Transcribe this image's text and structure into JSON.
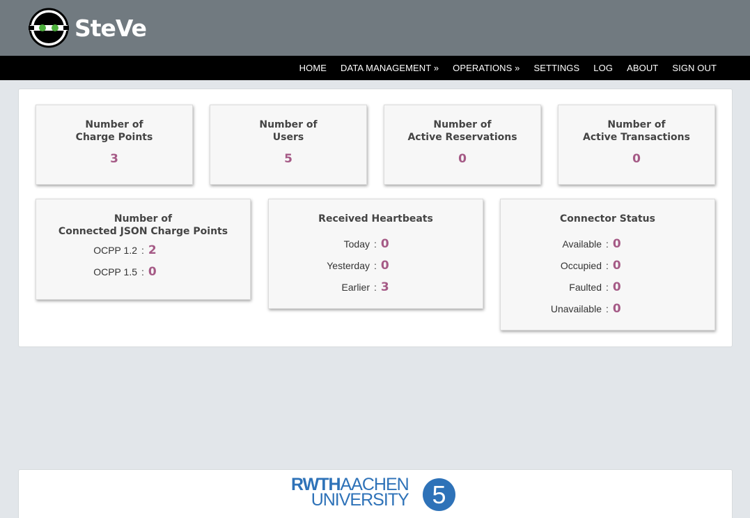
{
  "brand": {
    "name": "SteVe",
    "logo_icon": "robot-face-icon"
  },
  "nav": {
    "items": [
      {
        "label": "HOME"
      },
      {
        "label": "DATA MANAGEMENT »"
      },
      {
        "label": "OPERATIONS »"
      },
      {
        "label": "SETTINGS"
      },
      {
        "label": "LOG"
      },
      {
        "label": "ABOUT"
      },
      {
        "label": "SIGN OUT"
      }
    ]
  },
  "stats": {
    "charge_points": {
      "line1": "Number of",
      "line2": "Charge Points",
      "value": "3"
    },
    "users": {
      "line1": "Number of",
      "line2": "Users",
      "value": "5"
    },
    "reservations": {
      "line1": "Number of",
      "line2": "Active Reservations",
      "value": "0"
    },
    "transactions": {
      "line1": "Number of",
      "line2": "Active Transactions",
      "value": "0"
    }
  },
  "json_cp": {
    "line1": "Number of",
    "line2": "Connected JSON Charge Points",
    "rows": [
      {
        "label": "OCPP 1.2",
        "sep": ":",
        "value": "2"
      },
      {
        "label": "OCPP 1.5",
        "sep": ":",
        "value": "0"
      }
    ]
  },
  "heartbeats": {
    "title": "Received Heartbeats",
    "rows": [
      {
        "label": "Today",
        "sep": ":",
        "value": "0"
      },
      {
        "label": "Yesterday",
        "sep": ":",
        "value": "0"
      },
      {
        "label": "Earlier",
        "sep": ":",
        "value": "3"
      }
    ]
  },
  "connector": {
    "title": "Connector Status",
    "rows": [
      {
        "label": "Available",
        "sep": ":",
        "value": "0"
      },
      {
        "label": "Occupied",
        "sep": ":",
        "value": "0"
      },
      {
        "label": "Faulted",
        "sep": ":",
        "value": "0"
      },
      {
        "label": "Unavailable",
        "sep": ":",
        "value": "0"
      }
    ]
  },
  "footer": {
    "rwth_bold": "RWTH",
    "rwth_rest": "AACHEN",
    "rwth_line2": "UNIVERSITY",
    "i5": "5",
    "colors": {
      "brand_blue": "#2e72b8"
    }
  },
  "colors": {
    "value": "#a55a86",
    "header": "#717a80",
    "navbar": "#000000"
  }
}
